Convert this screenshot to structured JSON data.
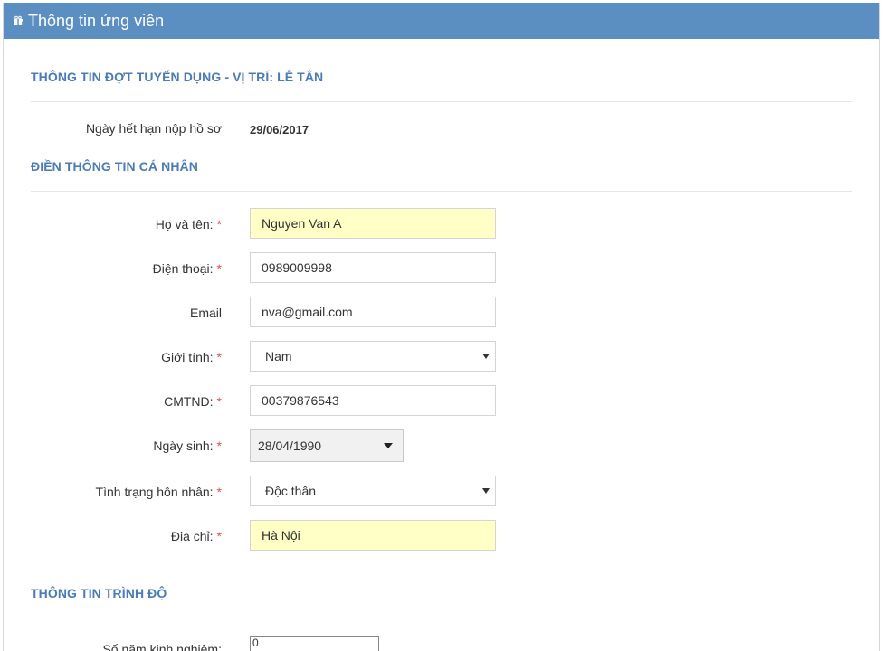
{
  "header": {
    "title": "Thông tin ứng viên"
  },
  "recruitment": {
    "title": "THÔNG TIN ĐỢT TUYỂN DỤNG - VỊ TRÍ: LỄ TÂN",
    "deadline_label": "Ngày hết hạn nộp hồ sơ",
    "deadline_value": "29/06/2017"
  },
  "personal": {
    "title": "ĐIỀN THÔNG TIN CÁ NHÂN",
    "fields": {
      "name": {
        "label": "Họ và tên:",
        "value": "Nguyen Van A"
      },
      "phone": {
        "label": "Điện thoại:",
        "value": "0989009998"
      },
      "email": {
        "label": "Email",
        "value": "nva@gmail.com"
      },
      "gender": {
        "label": "Giới tính:",
        "value": "Nam"
      },
      "id_card": {
        "label": "CMTND:",
        "value": "00379876543"
      },
      "dob": {
        "label": "Ngày sinh:",
        "value": "28/04/1990"
      },
      "marital": {
        "label": "Tình trạng hôn nhân:",
        "value": "Độc thân"
      },
      "address": {
        "label": "Địa chỉ:",
        "value": "Hà Nội"
      }
    },
    "required_mark": "*"
  },
  "education": {
    "title": "THÔNG TIN TRÌNH ĐỘ",
    "experience_label": "Số năm kinh nghiệm:",
    "experience_value": "0"
  },
  "colors": {
    "header_bg": "#5b8ec1",
    "section_title": "#4a7bb5",
    "required": "#d9534f",
    "highlight": "#ffffc6"
  }
}
